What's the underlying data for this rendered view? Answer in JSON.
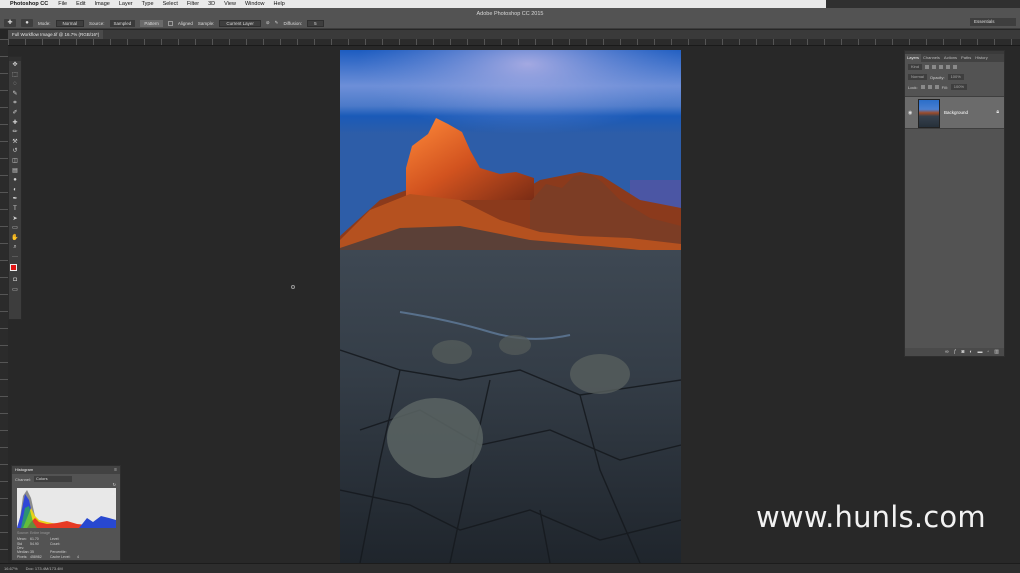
{
  "menubar": {
    "app_name": "Photoshop CC",
    "items": [
      "File",
      "Edit",
      "Image",
      "Layer",
      "Type",
      "Select",
      "Filter",
      "3D",
      "View",
      "Window",
      "Help"
    ]
  },
  "window": {
    "title": "Adobe Photoshop CC 2015"
  },
  "options": {
    "mode_label": "Mode:",
    "mode_value": "Normal",
    "source_label": "Source:",
    "source_sampled": "Sampled",
    "source_pattern": "Pattern",
    "aligned_label": "Aligned",
    "sample_label": "Sample:",
    "sample_value": "Current Layer",
    "diffusion_label": "Diffusion:",
    "diffusion_value": "5",
    "workspace": "Essentials"
  },
  "document": {
    "tab_label": "Full Workflow Image.tif @ 16.7% (RGB/16*)"
  },
  "toolbar": {
    "tools": [
      "move-icon",
      "marquee-icon",
      "lasso-icon",
      "quick-select-icon",
      "crop-icon",
      "eyedropper-icon",
      "healing-brush-icon",
      "brush-icon",
      "clone-stamp-icon",
      "history-brush-icon",
      "eraser-icon",
      "gradient-icon",
      "blur-icon",
      "dodge-icon",
      "pen-icon",
      "type-icon",
      "path-select-icon",
      "rectangle-icon",
      "hand-icon",
      "zoom-icon",
      "more-tools-icon"
    ],
    "glyphs": [
      "✥",
      "⬚",
      "◌",
      "✎",
      "⌗",
      "✐",
      "✚",
      "✏",
      "⚒",
      "↺",
      "◫",
      "▤",
      "●",
      "◐",
      "✒",
      "T",
      "➤",
      "▭",
      "✋",
      "⌕",
      "···"
    ],
    "foreground_color": "#e11414",
    "background_color": "#ffffff"
  },
  "layers_panel": {
    "tabs": [
      "Layers",
      "Channels",
      "Actions",
      "Paths",
      "History"
    ],
    "kind_label": "Kind",
    "blend_mode": "Normal",
    "opacity_label": "Opacity:",
    "opacity_value": "100%",
    "lock_label": "Lock:",
    "fill_label": "Fill:",
    "fill_value": "100%",
    "layer_name": "Background"
  },
  "histogram_panel": {
    "title": "Histogram",
    "channel_label": "Channel:",
    "channel_value": "Colors",
    "source_label": "Source:",
    "source_value": "Entire Image",
    "stats": [
      [
        "Mean:",
        "61.70",
        "Level:",
        ""
      ],
      [
        "Std Dev:",
        "54.90",
        "Count:",
        ""
      ],
      [
        "Median:",
        "35",
        "Percentile:",
        ""
      ],
      [
        "Pixels:",
        "458982",
        "Cache Level:",
        "4"
      ]
    ]
  },
  "status_bar": {
    "zoom": "16.67%",
    "doc_info": "Doc: 173.4M/173.4M"
  },
  "watermark": "www.hunls.com"
}
